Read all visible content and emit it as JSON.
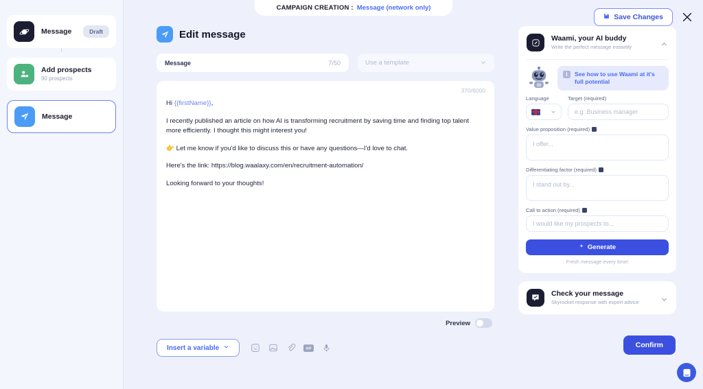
{
  "notch": {
    "label": "CAMPAIGN CREATION :",
    "value": "Message (network only)"
  },
  "topbar": {
    "save_label": "Save Changes",
    "close_icon": "close-icon",
    "save_icon": "floppy-disk-icon"
  },
  "sidebar": {
    "steps": [
      {
        "title": "Message",
        "sub": "",
        "badge": "Draft",
        "icon": "planet-icon",
        "selected": false
      },
      {
        "title": "Add prospects",
        "sub": "90 prospects",
        "badge": "",
        "icon": "add-user-icon",
        "selected": false
      },
      {
        "title": "Message",
        "sub": "",
        "badge": "",
        "icon": "paper-plane-icon",
        "selected": true
      }
    ]
  },
  "main": {
    "header": {
      "title": "Edit message",
      "icon": "paper-plane-icon"
    },
    "subject": {
      "label": "Message",
      "count": "7/50"
    },
    "template": {
      "placeholder": "Use a template",
      "chevron": "chevron-down-icon"
    },
    "editor": {
      "char_count": "370/8000",
      "greeting_prefix": "Hi ",
      "greeting_variable": "{{firstName}}",
      "greeting_suffix": ",",
      "paragraphs": [
        "I recently published an article on how AI is transforming recruitment by saving time and finding top talent more efficiently. I thought this might interest you!",
        "👉 Let me know if you'd like to discuss this or have any questions—I'd love to chat.",
        "Here's the link: https://blog.waalaxy.com/en/recruitment-automation/",
        "Looking forward to your thoughts!"
      ]
    },
    "preview": {
      "label": "Preview",
      "enabled": false
    },
    "insert_variable": {
      "label": "Insert a variable",
      "chevron": "chevron-down-icon"
    },
    "tool_icons": [
      "emoji-icon",
      "image-icon",
      "attachment-icon",
      "gif-icon",
      "microphone-icon"
    ]
  },
  "right_panel": {
    "waami": {
      "title": "Waami, your AI buddy",
      "subtitle": "Write the perfect message instantly",
      "icon": "pencil-square-icon",
      "chevron": "chevron-up-icon",
      "mascot": "robot-icon",
      "banner": {
        "text": "See how to use Waami at it's full potential",
        "icon": "info-icon"
      },
      "fields": {
        "language_label": "Language",
        "language_flag": "uk-flag-icon",
        "target_label": "Target (required)",
        "target_placeholder": "e.g: Business manager",
        "value_prop_label": "Value proposition (required)",
        "value_prop_placeholder": "I offer...",
        "differentiator_label": "Differentiating factor (required)",
        "differentiator_placeholder": "I stand out by...",
        "cta_label": "Call to action (required)",
        "cta_placeholder": "I would like my prospects to..."
      },
      "generate_label": "Generate",
      "generate_icon": "sparkle-icon",
      "generate_note": "Fresh message every time!"
    },
    "check": {
      "title": "Check your message",
      "subtitle": "Skyrocket response with expert advice",
      "icon": "chat-check-icon",
      "chevron": "chevron-down-icon"
    }
  },
  "footer": {
    "confirm_label": "Confirm",
    "chat_bubble_icon": "intercom-chat-icon"
  },
  "colors": {
    "accent": "#3b4fe0",
    "link": "#4a6cf7",
    "bg": "#eef1fb",
    "sidebar_bg": "#f4f6fd",
    "dark": "#1c1c33"
  }
}
